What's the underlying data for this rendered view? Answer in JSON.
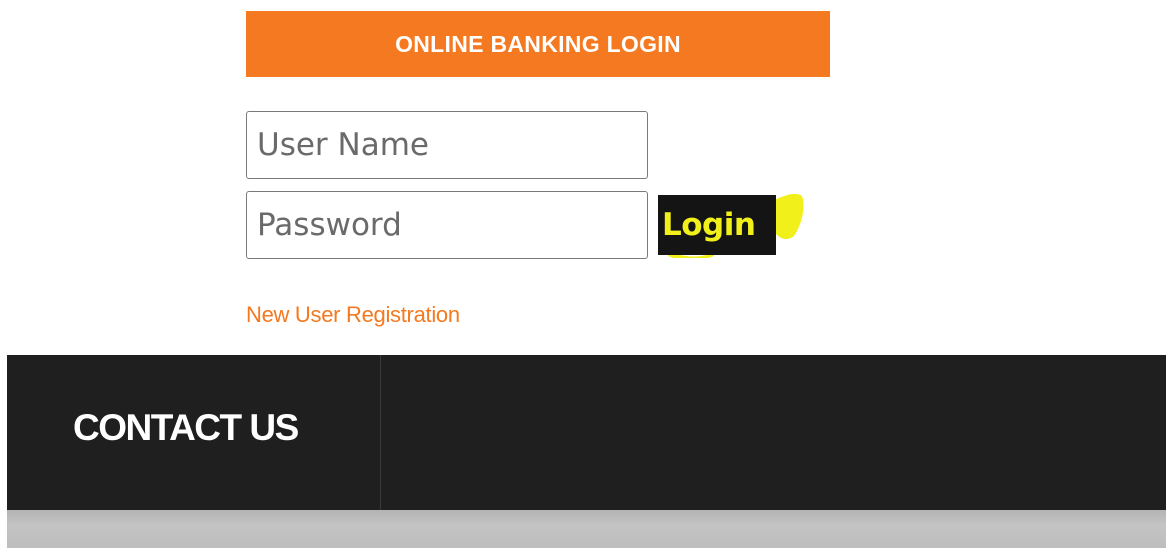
{
  "login_panel": {
    "title": "ONLINE BANKING LOGIN",
    "username_placeholder": "User Name",
    "password_placeholder": "Password",
    "login_label": "Login",
    "register_link": "New User Registration"
  },
  "footer": {
    "contact_heading": "CONTACT US"
  },
  "colors": {
    "accent_orange": "#f47920",
    "footer_dark": "#1f1f1f",
    "login_button_bg": "#141414",
    "login_text_yellow": "#f2f01a"
  }
}
